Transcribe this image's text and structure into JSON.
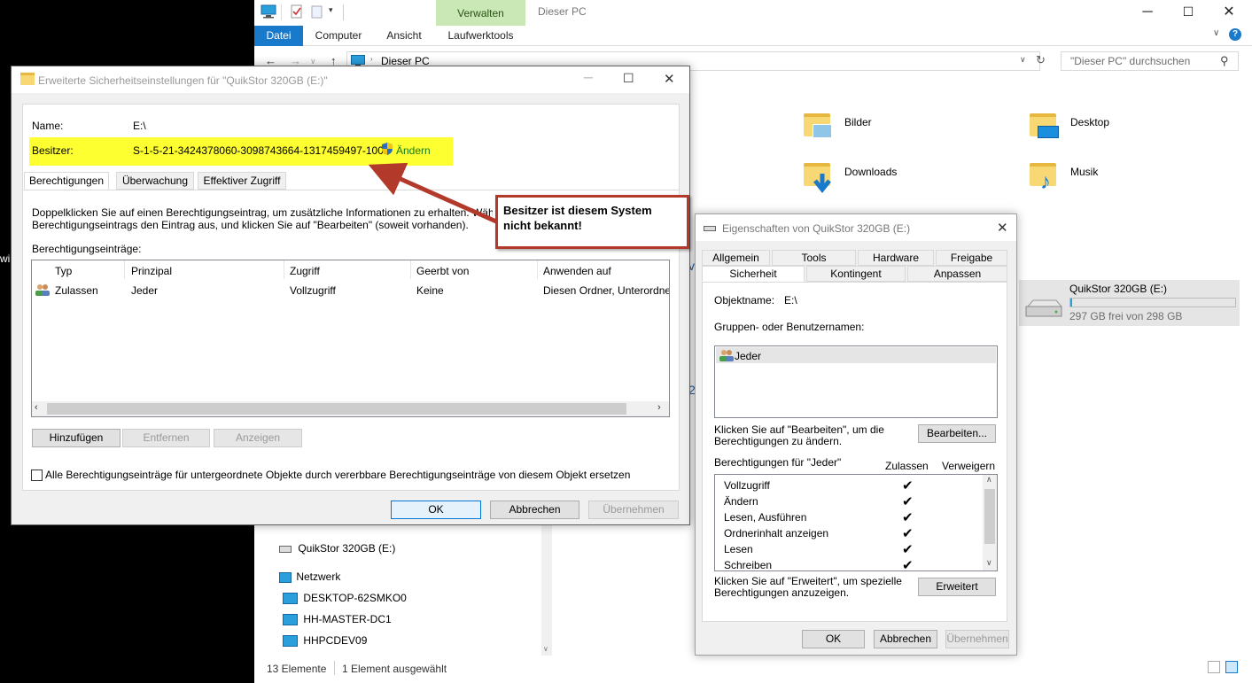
{
  "explorer": {
    "title": "Dieser PC",
    "context_tab": "Verwalten",
    "ribbon_tabs": [
      "Datei",
      "Computer",
      "Ansicht",
      "Laufwerktools"
    ],
    "address": "Dieser PC",
    "search_placeholder": "\"Dieser PC\" durchsuchen",
    "folders": [
      "Bilder",
      "Desktop",
      "Downloads",
      "Musik"
    ],
    "drive": {
      "name": "QuikStor 320GB (E:)",
      "free": "297 GB frei von 298 GB",
      "used_fraction": 0.01
    },
    "tree": {
      "drive": "QuikStor 320GB (E:)",
      "network": "Netzwerk",
      "computers": [
        "DESKTOP-62SMKO0",
        "HH-MASTER-DC1",
        "HHPCDEV09"
      ]
    },
    "status": {
      "count": "13 Elemente",
      "selected": "1 Element ausgewählt"
    }
  },
  "advanced": {
    "title": "Erweiterte Sicherheitseinstellungen für \"QuikStor 320GB (E:)\"",
    "name_label": "Name:",
    "name_value": "E:\\",
    "owner_label": "Besitzer:",
    "owner_value": "S-1-5-21-3424378060-3098743664-1317459497-1001",
    "change_link": "Ändern",
    "tabs": [
      "Berechtigungen",
      "Überwachung",
      "Effektiver Zugriff"
    ],
    "info_line1": "Doppelklicken Sie auf einen Berechtigungseintrag, um zusätzliche Informationen zu erhalten. Wähle",
    "info_line2": "Berechtigungseintrags den Eintrag aus, und klicken Sie auf \"Bearbeiten\" (soweit vorhanden).",
    "entries_label": "Berechtigungseinträge:",
    "columns": [
      "Typ",
      "Prinzipal",
      "Zugriff",
      "Geerbt von",
      "Anwenden auf"
    ],
    "rows": [
      {
        "type": "Zulassen",
        "principal": "Jeder",
        "access": "Vollzugriff",
        "inherited": "Keine",
        "apply": "Diesen Ordner, Unterordne"
      }
    ],
    "btn_add": "Hinzufügen",
    "btn_remove": "Entfernen",
    "btn_view": "Anzeigen",
    "replace_label": "Alle Berechtigungseinträge für untergeordnete Objekte durch vererbbare Berechtigungseinträge von diesem Objekt ersetzen",
    "ok": "OK",
    "cancel": "Abbrechen",
    "apply": "Übernehmen"
  },
  "properties": {
    "title": "Eigenschaften von QuikStor 320GB (E:)",
    "tabs_row1": [
      "Allgemein",
      "Tools",
      "Hardware",
      "Freigabe"
    ],
    "tabs_row2": [
      "Sicherheit",
      "Kontingent",
      "Anpassen"
    ],
    "object_label": "Objektname:",
    "object_value": "E:\\",
    "groups_label": "Gruppen- oder Benutzernamen:",
    "groups": [
      "Jeder"
    ],
    "edit_hint_1": "Klicken Sie auf \"Bearbeiten\", um die",
    "edit_hint_2": "Berechtigungen zu ändern.",
    "edit_button": "Bearbeiten...",
    "perm_header": "Berechtigungen für \"Jeder\"",
    "allow_header": "Zulassen",
    "deny_header": "Verweigern",
    "permissions": [
      "Vollzugriff",
      "Ändern",
      "Lesen, Ausführen",
      "Ordnerinhalt anzeigen",
      "Lesen",
      "Schreiben"
    ],
    "check_glyph": "✔",
    "adv_hint_1": "Klicken Sie auf \"Erweitert\", um spezielle",
    "adv_hint_2": "Berechtigungen anzuzeigen.",
    "adv_button": "Erweitert",
    "ok": "OK",
    "cancel": "Abbrechen",
    "apply": "Übernehmen"
  },
  "annotation": {
    "line1": "Besitzer ist diesem System",
    "line2": "nicht bekannt!",
    "color": "#b33a2a"
  },
  "colors": {
    "accent": "#1979ca",
    "highlight": "#fdff30",
    "context_tab": "#c9e8b5"
  }
}
